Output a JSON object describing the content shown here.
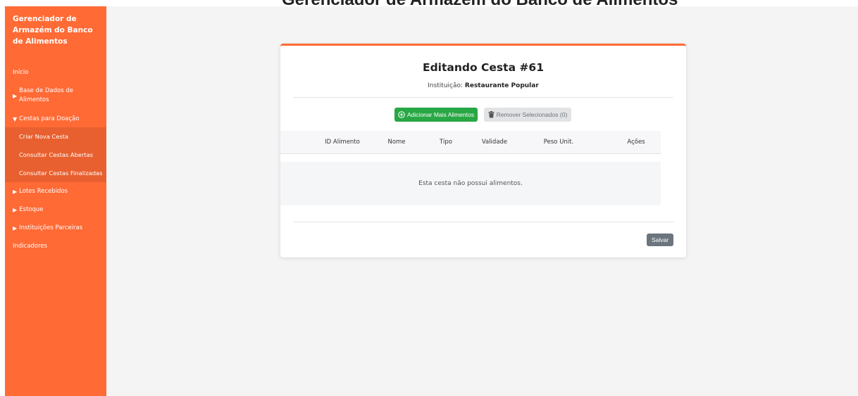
{
  "page_header": "Gerenciador de Armazém do Banco de Alimentos",
  "sidebar": {
    "brand": "Gerenciador de Armazém do Banco de Alimentos",
    "items": [
      {
        "label": "Início",
        "marker": ""
      },
      {
        "label": "Base de Dados de Alimentos",
        "marker": "▶"
      },
      {
        "label": "Cestas para Doação",
        "marker": "▼"
      },
      {
        "label": "Lotes Recebidos",
        "marker": "▶"
      },
      {
        "label": "Estoque",
        "marker": "▶"
      },
      {
        "label": "Instituições Parceiras",
        "marker": "▶"
      },
      {
        "label": "Indicadores",
        "marker": ""
      }
    ],
    "subitems": [
      {
        "label": "Criar Nova Cesta"
      },
      {
        "label": "Consultar Cestas Abertas"
      },
      {
        "label": "Consultar Cestas Finalizadas"
      }
    ]
  },
  "card": {
    "title": "Editando Cesta #61",
    "institution_label": "Instituição:",
    "institution_name": "Restaurante Popular",
    "add_button": "Adicionar Mais Alimentos",
    "remove_button": "Remover Selecionados (0)",
    "table_headers": [
      "ID Alimento",
      "Nome",
      "Tipo",
      "Validade",
      "Peso Unit.",
      "Ações"
    ],
    "empty_message": "Esta cesta não possui alimentos.",
    "save_button": "Salvar"
  },
  "colors": {
    "accent": "#ff6a35",
    "sidebar_active": "#e8602f",
    "success": "#28a745",
    "secondary": "#6c757d"
  },
  "icons": {
    "add": "plus-circle-icon",
    "remove": "trash-icon"
  }
}
